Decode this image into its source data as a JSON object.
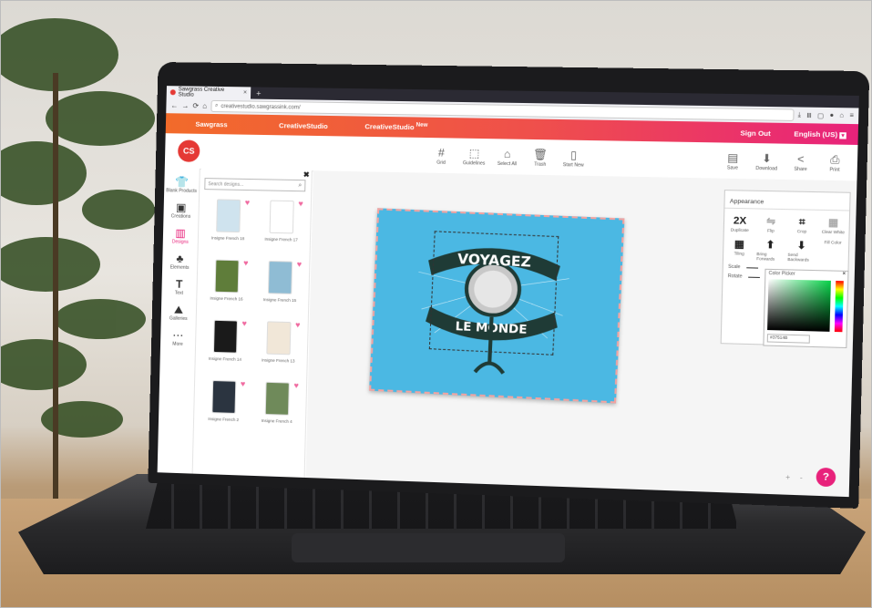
{
  "browser": {
    "tab_title": "Sawgrass Creative Studio",
    "url": "creativestudio.sawgrassink.com/"
  },
  "app_nav": {
    "sawgrass": "Sawgrass",
    "creative_studio": "CreativeStudio",
    "creative_studio_new": "CreativeStudio",
    "new_badge": "New",
    "sign_out": "Sign Out",
    "language": "English (US)"
  },
  "logo": "CS",
  "toolbar": {
    "center": [
      "Grid",
      "Guidelines",
      "Select All",
      "Trash",
      "Start New"
    ],
    "right": [
      "Save",
      "Download",
      "Share",
      "Print"
    ]
  },
  "rail": [
    "Blank Products",
    "Creations",
    "Designs",
    "Elements",
    "Text",
    "Galleries",
    "More"
  ],
  "designs_panel": {
    "search_placeholder": "Search designs...",
    "items": [
      {
        "caption": "Insigne French 18",
        "color": "#cfe3ee"
      },
      {
        "caption": "Insigne French 17",
        "color": "#ffffff"
      },
      {
        "caption": "Insigne French 16",
        "color": "#5f7d3a"
      },
      {
        "caption": "Insigne French 15",
        "color": "#8fbcd4"
      },
      {
        "caption": "Insigne French 14",
        "color": "#1a1a1a"
      },
      {
        "caption": "Insigne French 13",
        "color": "#f1e7d8"
      },
      {
        "caption": "Insigne French 2",
        "color": "#2b3440"
      },
      {
        "caption": "Insigne French 4",
        "color": "#6f8a5a"
      }
    ]
  },
  "artwork": {
    "line1": "VOYAGEZ",
    "line2": "LE MONDE",
    "bg_color": "#4bb8e3"
  },
  "appearance": {
    "title": "Appearance",
    "duplicate_glyph": "2X",
    "row1": [
      "Duplicate",
      "Flip",
      "Crop",
      "Clear White"
    ],
    "row2": [
      "Tiling",
      "Bring Forwards",
      "Send Backwards",
      "Fill Color"
    ],
    "scale": "Scale",
    "rotate": "Rotate"
  },
  "color_picker": {
    "title": "Color Picker",
    "hex": "#37514B"
  },
  "zoom": {
    "plus": "+",
    "minus": "-"
  },
  "help": "?"
}
